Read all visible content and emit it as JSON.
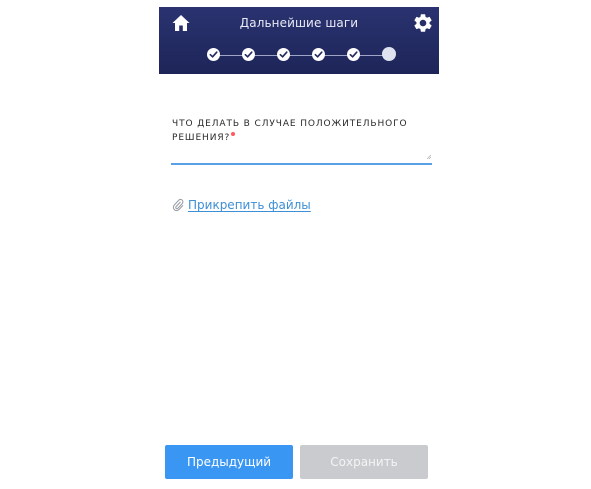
{
  "header": {
    "title": "Дальнейшие шаги",
    "background_color": "#23295f",
    "left_icon": "home-icon",
    "right_icon": "gear-icon"
  },
  "stepper": {
    "total_steps": 6,
    "completed_steps": 5,
    "current_step": 6,
    "completed_icon": "check-icon"
  },
  "question": {
    "label": "ЧТО ДЕЛАТЬ В СЛУЧАЕ ПОЛОЖИТЕЛЬНОГО РЕШЕНИЯ?",
    "required": true,
    "required_color": "#ff5a5f",
    "value": "",
    "placeholder": ""
  },
  "attachment": {
    "label": "Прикрепить файлы",
    "icon": "paperclip-icon",
    "link_color": "#3d8fd6"
  },
  "footer": {
    "prev_label": "Предыдущий",
    "save_label": "Сохранить",
    "prev_color": "#3a96f3",
    "save_disabled": true,
    "save_color": "#c9cbce"
  }
}
